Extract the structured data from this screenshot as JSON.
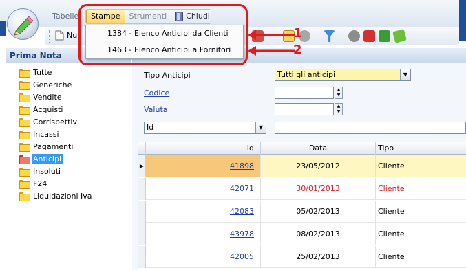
{
  "ribbon": {
    "tabs": [
      "Tabelle"
    ],
    "new_label": "Nu"
  },
  "menu": {
    "tabs": [
      "Stampe",
      "Strumenti",
      "Chiudi"
    ],
    "items": [
      "1384 - Elenco Anticipi da Clienti",
      "1463 - Elenco Anticipi a Fornitori"
    ]
  },
  "annotations": {
    "arrow1": "1",
    "arrow2": "2"
  },
  "sidebar": {
    "title": "Prima Nota",
    "items": [
      {
        "label": "Tutte"
      },
      {
        "label": "Generiche"
      },
      {
        "label": "Vendite"
      },
      {
        "label": "Acquisti"
      },
      {
        "label": "Corrispettivi"
      },
      {
        "label": "Incassi"
      },
      {
        "label": "Pagamenti"
      },
      {
        "label": "Anticipi",
        "selected": true
      },
      {
        "label": "Insoluti"
      },
      {
        "label": "F24"
      },
      {
        "label": "Liquidazioni Iva"
      }
    ]
  },
  "filters": {
    "tipo_label": "Tipo Anticipi",
    "tipo_value": "Tutti gli anticipi",
    "codice_label": "Codice",
    "valuta_label": "Valuta",
    "field_value": "Id"
  },
  "grid": {
    "columns": [
      "Id",
      "Data",
      "Tipo"
    ],
    "rows": [
      {
        "id": "41898",
        "date": "23/05/2012",
        "tipo": "Cliente",
        "selected": true
      },
      {
        "id": "42071",
        "date": "30/01/2013",
        "tipo": "Cliente",
        "red": true
      },
      {
        "id": "42083",
        "date": "05/02/2013",
        "tipo": "Cliente"
      },
      {
        "id": "43978",
        "date": "08/02/2013",
        "tipo": "Cliente"
      },
      {
        "id": "42005",
        "date": "25/02/2013",
        "tipo": "Cliente"
      }
    ]
  },
  "colors": {
    "accent": "#e11a1a",
    "link": "#1f3ea8",
    "selection": "#3399ff"
  }
}
